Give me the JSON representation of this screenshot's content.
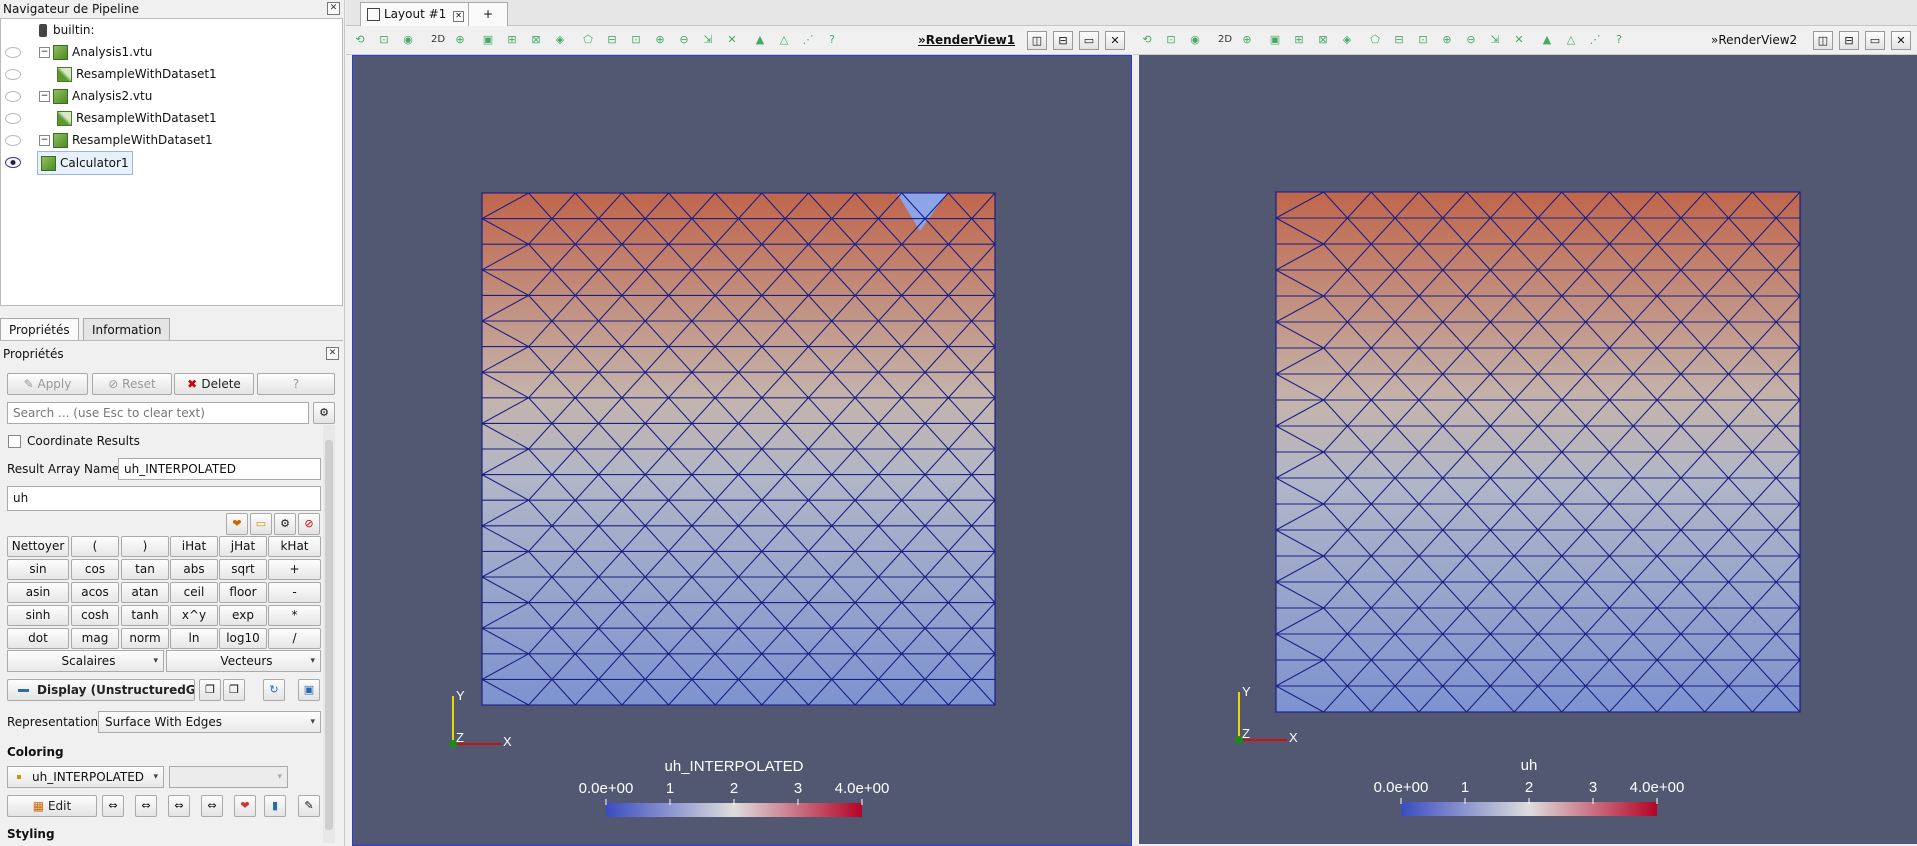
{
  "pipeline": {
    "title": "Navigateur de Pipeline",
    "items": [
      {
        "label": "builtin:"
      },
      {
        "label": "Analysis1.vtu"
      },
      {
        "label": "ResampleWithDataset1"
      },
      {
        "label": "Analysis2.vtu"
      },
      {
        "label": "ResampleWithDataset1"
      },
      {
        "label": "ResampleWithDataset1"
      },
      {
        "label": "Calculator1"
      }
    ]
  },
  "tabs": {
    "properties": "Propriétés",
    "information": "Information"
  },
  "props": {
    "title": "Propriétés",
    "apply": "Apply",
    "reset": "Reset",
    "delete": "Delete",
    "help": "?",
    "search_placeholder": "Search ... (use Esc to clear text)",
    "coordinate_results": "Coordinate Results",
    "result_array_label": "Result Array Name",
    "result_array_value": "uh_INTERPOLATED",
    "expression": "uh",
    "calc_rows": [
      [
        "Nettoyer",
        "(",
        ")",
        "iHat",
        "jHat",
        "kHat"
      ],
      [
        "sin",
        "cos",
        "tan",
        "abs",
        "sqrt",
        "+"
      ],
      [
        "asin",
        "acos",
        "atan",
        "ceil",
        "floor",
        "-"
      ],
      [
        "sinh",
        "cosh",
        "tanh",
        "x^y",
        "exp",
        "*"
      ],
      [
        "dot",
        "mag",
        "norm",
        "ln",
        "log10",
        "/"
      ]
    ],
    "scalaires": "Scalaires",
    "vecteurs": "Vecteurs",
    "display_label": "Display (UnstructuredG",
    "representation_label": "Representation",
    "representation_value": "Surface With Edges",
    "coloring": "Coloring",
    "coloring_value": "uh_INTERPOLATED",
    "edit": "Edit",
    "styling": "Styling"
  },
  "layout": {
    "tab": "Layout #1",
    "add": "+"
  },
  "views": [
    {
      "title": "RenderView1",
      "legend_title": "uh_INTERPOLATED",
      "ticks": [
        "0.0e+00",
        "1",
        "2",
        "3",
        "4.0e+00"
      ],
      "axes": {
        "y": "Y",
        "z": "Z",
        "x": "X"
      }
    },
    {
      "title": "RenderView2",
      "legend_title": "uh",
      "ticks": [
        "0.0e+00",
        "1",
        "2",
        "3",
        "4.0e+00"
      ],
      "axes": {
        "y": "Y",
        "z": "Z",
        "x": "X"
      }
    }
  ],
  "colors": {
    "view_bg": "#525872",
    "mesh_edge": "#1c1f85",
    "cmap_low": "#3b4cc0",
    "cmap_mid": "#dddddd",
    "cmap_high": "#b40426"
  },
  "toolbar": {
    "two_d": "2D"
  }
}
